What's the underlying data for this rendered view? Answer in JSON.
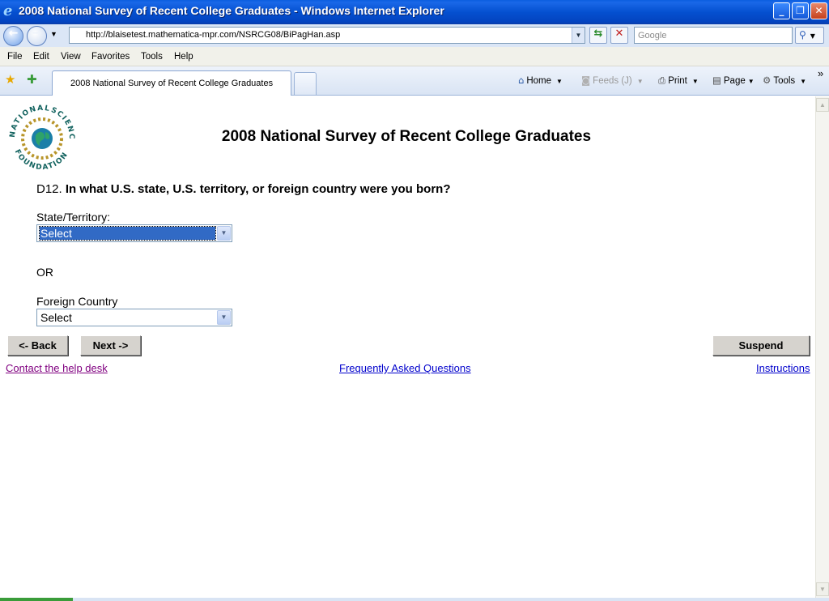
{
  "window": {
    "title": "2008 National Survey of Recent College Graduates - Windows Internet Explorer",
    "minimize": "_",
    "restore": "❐",
    "close": "✕"
  },
  "addressbar": {
    "url": "http://blaisetest.mathematica-mpr.com/NSRCG08/BiPagHan.asp",
    "search_placeholder": "Google"
  },
  "menu": [
    "File",
    "Edit",
    "View",
    "Favorites",
    "Tools",
    "Help"
  ],
  "tab": {
    "label": "2008 National Survey of Recent College Graduates"
  },
  "commands": {
    "home": "Home",
    "feeds": "Feeds (J)",
    "print": "Print",
    "page": "Page",
    "tools": "Tools",
    "more": "»"
  },
  "page": {
    "logo_text": [
      "NATIONAL",
      "SCIENCE",
      "FOUNDATION"
    ],
    "title": "2008 National Survey of Recent College Graduates",
    "question": {
      "number": "D12.",
      "text": "In what U.S. state, U.S. territory, or foreign country were you born?"
    },
    "state_label": "State/Territory:",
    "state_value": "Select",
    "or_label": "OR",
    "country_label": "Foreign Country",
    "country_value": "Select",
    "back_button": "<- Back",
    "next_button": "Next ->",
    "suspend_button": "Suspend",
    "help_link": "Contact the help desk",
    "faq_link": "Frequently Asked Questions",
    "instructions_link": "Instructions"
  },
  "colors": {
    "titlebar": "#0450d0",
    "visited_link": "#800080",
    "link": "#0000cc",
    "select_highlight": "#316ac5"
  }
}
